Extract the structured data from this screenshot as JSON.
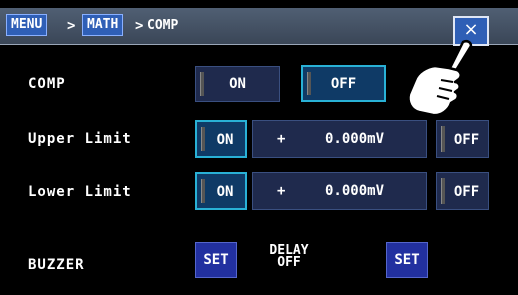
{
  "breadcrumb": {
    "menu": "MENU",
    "sep1": ">",
    "math": "MATH",
    "sep2": ">",
    "current": "COMP"
  },
  "close": {
    "label": "×"
  },
  "comp": {
    "label": "COMP",
    "on": "ON",
    "off": "OFF",
    "selected": "OFF"
  },
  "upper": {
    "label": "Upper Limit",
    "on": "ON",
    "sign": "+",
    "value": "0.000mV",
    "off": "OFF",
    "selected": "ON"
  },
  "lower": {
    "label": "Lower Limit",
    "on": "ON",
    "sign": "+",
    "value": "0.000mV",
    "off": "OFF",
    "selected": "ON"
  },
  "buzzer": {
    "label": "BUZZER",
    "set": "SET"
  },
  "delay": {
    "line1": "DELAY",
    "line2": "OFF",
    "set": "SET"
  },
  "colors": {
    "background": "#000000",
    "button": "#1f2a4d",
    "active_border": "#29b1d6",
    "title_accent": "#2f5fb6"
  }
}
